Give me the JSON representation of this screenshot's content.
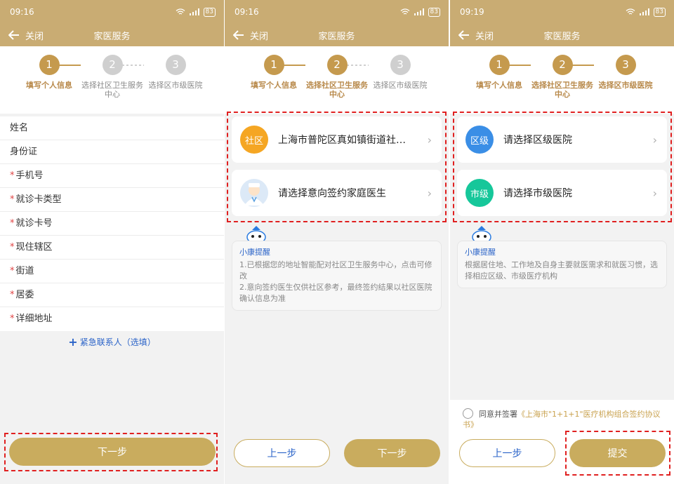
{
  "colors": {
    "brand": "#c9ac73",
    "accent": "#c59a4e",
    "link": "#2a63c8",
    "required": "#e04545"
  },
  "common": {
    "back_icon": "arrow-left-icon",
    "close_label": "关闭",
    "title": "家医服务"
  },
  "steps": {
    "s1": {
      "num": "1",
      "label": "填写个人信息"
    },
    "s2": {
      "num": "2",
      "label": "选择社区卫生服务中心"
    },
    "s3": {
      "num": "3",
      "label": "选择区市级医院"
    }
  },
  "screen1": {
    "time": "09:16",
    "battery": "83",
    "fields": {
      "name": "姓名",
      "id": "身份证",
      "phone": "手机号",
      "card_type": "就诊卡类型",
      "card_no": "就诊卡号",
      "town": "现住辖区",
      "street": "街道",
      "committee": "居委",
      "address": "详细地址"
    },
    "required_mark": "*",
    "emergency_label": "紧急联系人（选填）",
    "next_label": "下一步"
  },
  "screen2": {
    "time": "09:16",
    "battery": "83",
    "community_badge": "社区",
    "community_value": "上海市普陀区真如镇街道社…",
    "doctor_placeholder": "请选择意向签约家庭医生",
    "tip_title": "小康提醒",
    "tip_1": "1.已根据您的地址智能配对社区卫生服务中心，点击可修改",
    "tip_2": "2.意向签约医生仅供社区参考，最终签约结果以社区医院确认信息为准",
    "prev_label": "上一步",
    "next_label": "下一步"
  },
  "screen3": {
    "time": "09:19",
    "battery": "83",
    "district_badge": "区级",
    "district_placeholder": "请选择区级医院",
    "city_badge": "市级",
    "city_placeholder": "请选择市级医院",
    "tip_title": "小康提醒",
    "tip_text": "根据居住地、工作地及自身主要就医需求和就医习惯，选择相应区级、市级医疗机构",
    "agree_prefix": "同意并签署",
    "agree_link": "《上海市\"1+1+1\"医疗机构组合签约协议书》",
    "prev_label": "上一步",
    "submit_label": "提交"
  }
}
